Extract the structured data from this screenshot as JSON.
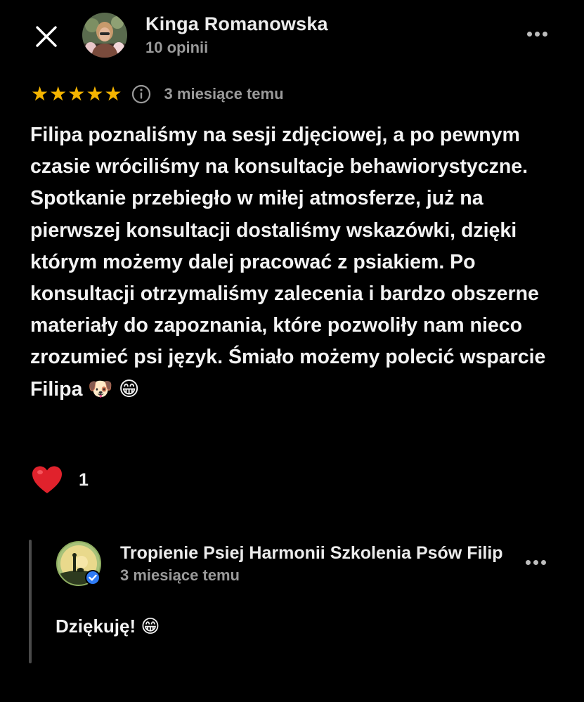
{
  "header": {
    "author_name": "Kinga Romanowska",
    "author_reviews": "10 opinii",
    "icons": {
      "close": "close-icon",
      "more": "more-options-icon"
    }
  },
  "review": {
    "rating": 5,
    "rating_max": 5,
    "date": "3 miesiące temu",
    "text": "Filipa poznaliśmy na sesji zdjęciowej, a po pewnym czasie wróciliśmy na konsultacje behawiorystyczne. Spotkanie przebiegło w miłej atmosferze, już na pierwszej konsultacji dostaliśmy wskazówki, dzięki którym możemy dalej pracować z psiakiem. Po konsultacji otrzymaliśmy zalecenia i bardzo obszerne materiały do zapoznania, które pozwoliły nam nieco zrozumieć psi język. Śmiało możemy polecić wsparcie Filipa",
    "emojis": [
      "🐶",
      "😁"
    ],
    "star_color": "#f4b400"
  },
  "reactions": {
    "heart_emoji": "❤️",
    "count": "1"
  },
  "owner_reply": {
    "name": "Tropienie Psiej Harmonii Szkolenia Psów Filip",
    "date": "3 miesiące temu",
    "text": "Dziękuję!",
    "emoji": "😁",
    "verified_color": "#2f7cf6"
  },
  "colors": {
    "background": "#000000",
    "text_primary": "#f3f3f3",
    "text_secondary": "#9a9a9a"
  }
}
